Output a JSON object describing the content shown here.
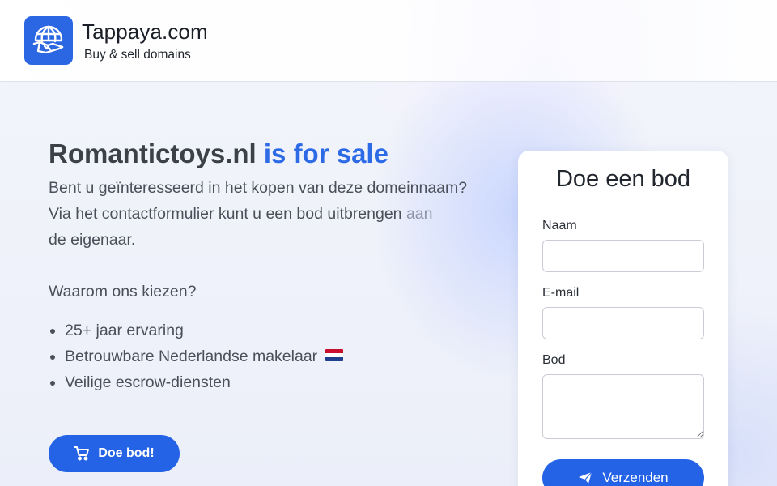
{
  "header": {
    "brand_name": "Tappaya.com",
    "brand_tagline": "Buy & sell domains",
    "logo_icon": "globe-handshake-icon"
  },
  "hero": {
    "domain": "Romantictoys.nl",
    "title_suffix": "is for sale",
    "intro_line1": "Bent u geïnteresseerd in het kopen van deze domeinnaam?",
    "intro_line2_main": "Via het contactformulier kunt u een bod uitbrengen",
    "intro_line2_faded": "aan",
    "intro_line2_end": "de eigenaar.",
    "why_heading": "Waarom ons kiezen?",
    "benefits": [
      "25+ jaar ervaring",
      "Betrouwbare Nederlandse makelaar",
      "Veilige escrow-diensten"
    ],
    "flag_icon": "dutch-flag-icon",
    "cta_label": "Doe bod!",
    "cta_icon": "cart-icon"
  },
  "form": {
    "title": "Doe een bod",
    "name_label": "Naam",
    "name_value": "",
    "email_label": "E-mail",
    "email_value": "",
    "bid_label": "Bod",
    "bid_value": "",
    "submit_label": "Verzenden",
    "submit_icon": "paper-plane-icon"
  },
  "colors": {
    "accent": "#2563e6",
    "title_accent": "#2d6ae6",
    "logo_bg": "#2b66e3"
  }
}
